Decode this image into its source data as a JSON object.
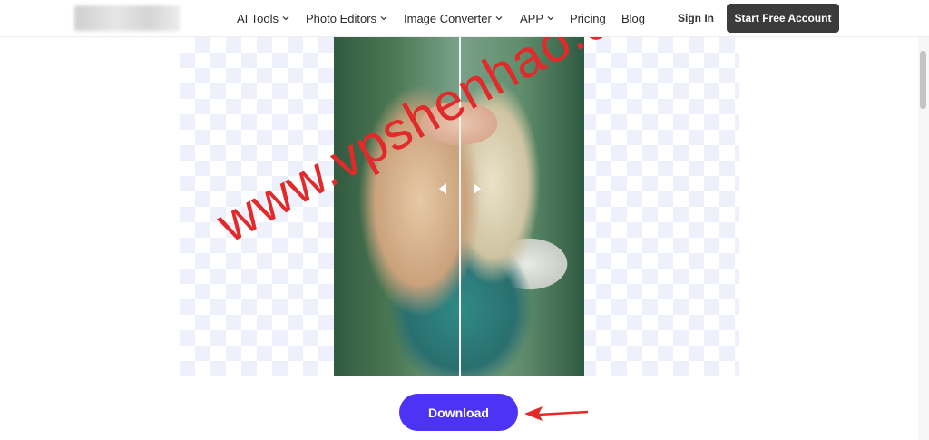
{
  "header": {
    "nav": [
      {
        "label": "AI Tools",
        "has_dropdown": true
      },
      {
        "label": "Photo Editors",
        "has_dropdown": true
      },
      {
        "label": "Image Converter",
        "has_dropdown": true
      },
      {
        "label": "APP",
        "has_dropdown": true
      },
      {
        "label": "Pricing",
        "has_dropdown": false
      },
      {
        "label": "Blog",
        "has_dropdown": false
      }
    ],
    "sign_in": "Sign In",
    "cta": "Start Free Account"
  },
  "preview": {
    "icon": "compare-slider-icon"
  },
  "watermark": "www.vpshenhao.com",
  "download_button": "Download",
  "colors": {
    "accent": "#4d34f5",
    "cta_bg": "#3b3b3b",
    "annotation_red": "#e22a2a"
  }
}
